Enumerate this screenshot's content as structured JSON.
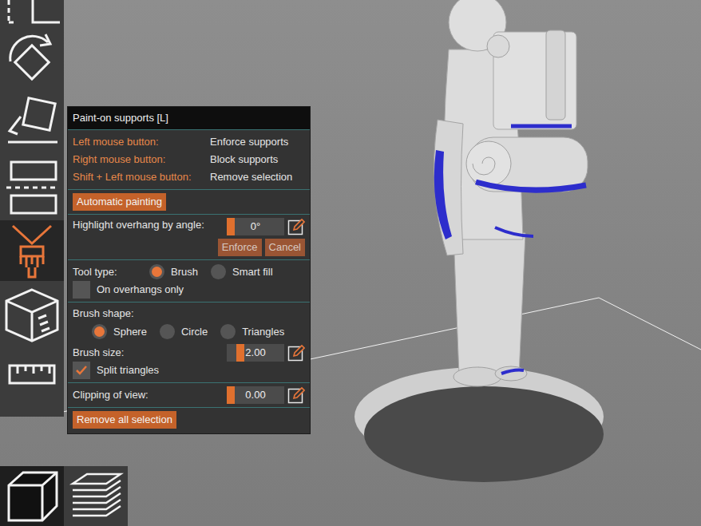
{
  "panel": {
    "title": "Paint-on supports [L]",
    "shortcuts": [
      {
        "key": "Left mouse button:",
        "action": "Enforce supports"
      },
      {
        "key": "Right mouse button:",
        "action": "Block supports"
      },
      {
        "key": "Shift + Left mouse button:",
        "action": "Remove selection"
      }
    ],
    "auto_button": {
      "label": "Automatic painting",
      "disabled": false
    },
    "highlight": {
      "label": "Highlight overhang by angle:",
      "value": "0°",
      "level": 0,
      "buttons": [
        {
          "label": "Enforce",
          "disabled": true
        },
        {
          "label": "Cancel",
          "disabled": true
        }
      ]
    },
    "tool_type": {
      "label": "Tool type:",
      "options": [
        {
          "label": "Brush",
          "selected": true
        },
        {
          "label": "Smart fill",
          "selected": false
        }
      ]
    },
    "overhangs_only": {
      "label": "On overhangs only",
      "checked": false
    },
    "brush_shape": {
      "label": "Brush shape:",
      "options": [
        {
          "label": "Sphere",
          "selected": true
        },
        {
          "label": "Circle",
          "selected": false
        },
        {
          "label": "Triangles",
          "selected": false
        }
      ]
    },
    "brush_size": {
      "label": "Brush size:",
      "value": "2.00",
      "level": 0.2
    },
    "split_triangles": {
      "label": "Split triangles",
      "checked": true
    },
    "clipping": {
      "label": "Clipping of view:",
      "value": "0.00",
      "level": 0
    },
    "remove_button": {
      "label": "Remove all selection",
      "disabled": false
    }
  },
  "toolbar": {
    "items": [
      {
        "kind": "select",
        "selected": false
      },
      {
        "kind": "rotate",
        "selected": false
      },
      {
        "kind": "place",
        "selected": false
      },
      {
        "kind": "cut",
        "selected": false
      },
      {
        "kind": "paint",
        "selected": true
      },
      {
        "kind": "seam",
        "selected": false
      },
      {
        "kind": "measure",
        "selected": false
      }
    ]
  },
  "view_bar": {
    "items": [
      {
        "kind": "view3d",
        "selected": true
      },
      {
        "kind": "preview",
        "selected": false
      }
    ]
  }
}
